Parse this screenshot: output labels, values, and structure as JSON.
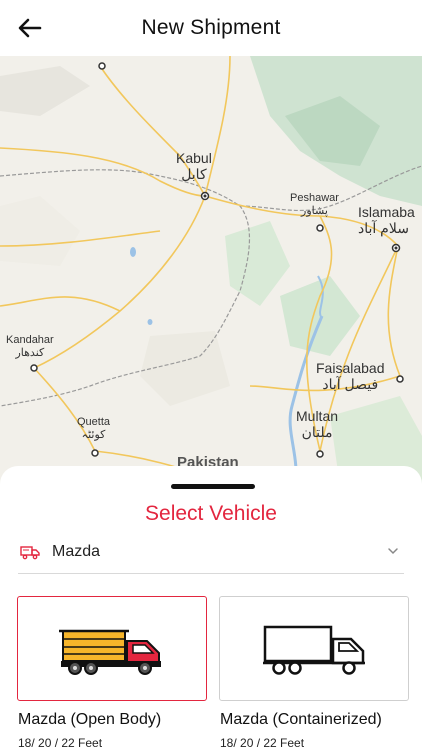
{
  "header": {
    "title": "New Shipment",
    "back_icon": "arrow-left-icon"
  },
  "map": {
    "cities": [
      {
        "id": "kabul",
        "en": "Kabul",
        "ur": "کابل"
      },
      {
        "id": "peshawar",
        "en": "Peshawar",
        "ur": "پشاور"
      },
      {
        "id": "islamabad",
        "en": "Islamaba",
        "ur": "سلام آباد"
      },
      {
        "id": "kandahar",
        "en": "Kandahar",
        "ur": "کندھار"
      },
      {
        "id": "quetta",
        "en": "Quetta",
        "ur": "کوئٹہ"
      },
      {
        "id": "faisalabad",
        "en": "Faisalabad",
        "ur": "فیصل آباد"
      },
      {
        "id": "multan",
        "en": "Multan",
        "ur": "ملتان"
      },
      {
        "id": "pakistan",
        "en": "Pakistan",
        "ur": ""
      }
    ]
  },
  "sheet": {
    "title": "Select Vehicle",
    "selected_vehicle": "Mazda",
    "vehicle_icon": "truck-icon",
    "dropdown_icon": "chevron-down-icon",
    "accent_color": "#e3263f",
    "options": [
      {
        "label": "Mazda (Open Body)",
        "sizes": "18/ 20 / 22 Feet",
        "selected": true
      },
      {
        "label": "Mazda (Containerized)",
        "sizes": "18/ 20 / 22 Feet",
        "selected": false
      }
    ]
  }
}
